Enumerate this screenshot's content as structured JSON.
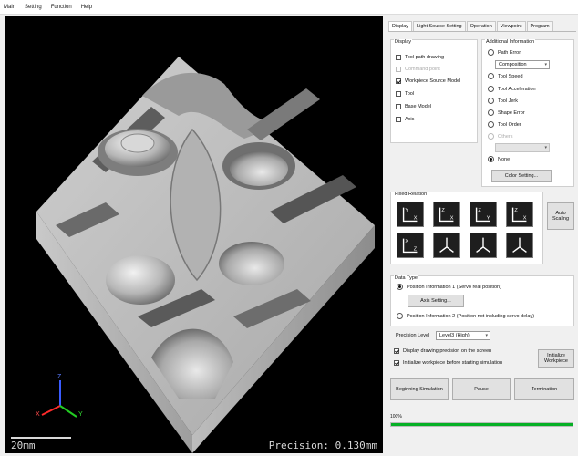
{
  "menu": [
    "Main",
    "Setting",
    "Function",
    "Help"
  ],
  "viewport": {
    "scale_label": "20mm",
    "precision_label": "Precision: 0.130mm",
    "axis_x": "X",
    "axis_y": "Y",
    "axis_z": "Z"
  },
  "tabs": [
    {
      "label": "Display",
      "active": true
    },
    {
      "label": "Light Source Setting",
      "active": false
    },
    {
      "label": "Operation",
      "active": false
    },
    {
      "label": "Viewpoint",
      "active": false
    },
    {
      "label": "Program",
      "active": false
    }
  ],
  "display_group": {
    "title": "Display",
    "items": [
      {
        "label": "Tool path drawing",
        "checked": false,
        "disabled": false
      },
      {
        "label": "Command point",
        "checked": false,
        "disabled": true
      },
      {
        "label": "Workpiece Source Model",
        "checked": true,
        "disabled": false
      },
      {
        "label": "Tool",
        "checked": false,
        "disabled": false
      },
      {
        "label": "Base Model",
        "checked": false,
        "disabled": false
      },
      {
        "label": "Axis",
        "checked": false,
        "disabled": false
      }
    ]
  },
  "additional_group": {
    "title": "Additional Information",
    "options": [
      {
        "label": "Path Error",
        "checked": false,
        "disabled": false
      },
      {
        "label": "Tool Speed",
        "checked": false,
        "disabled": false
      },
      {
        "label": "Tool Acceleration",
        "checked": false,
        "disabled": false
      },
      {
        "label": "Tool Jerk",
        "checked": false,
        "disabled": false
      },
      {
        "label": "Shape Error",
        "checked": false,
        "disabled": false
      },
      {
        "label": "Tool Order",
        "checked": false,
        "disabled": false
      },
      {
        "label": "Others",
        "checked": false,
        "disabled": true
      },
      {
        "label": "None",
        "checked": true,
        "disabled": false
      }
    ],
    "path_error_select": "Composition",
    "others_select": "",
    "color_setting_label": "Color Setting..."
  },
  "fixed_relation": {
    "title": "Fixed Relation",
    "buttons": [
      {
        "name": "view-yx",
        "a": "Y",
        "b": "X"
      },
      {
        "name": "view-xy",
        "a": "X",
        "b": "Y"
      },
      {
        "name": "view-zy",
        "a": "Z",
        "b": "Y"
      },
      {
        "name": "view-zx",
        "a": "Z",
        "b": "X"
      },
      {
        "name": "view-xz",
        "a": "X",
        "b": "Z"
      },
      {
        "name": "view-iso1",
        "a": "Z",
        "b": "X"
      },
      {
        "name": "view-iso2",
        "a": "Z",
        "b": "Y"
      },
      {
        "name": "view-iso3",
        "a": "Z",
        "b": "X"
      }
    ],
    "auto_scaling_label": "Auto Scaling"
  },
  "data_type": {
    "title": "Data Type",
    "option1": "Position Information 1 (Servo real position)",
    "option1_checked": true,
    "axis_setting_label": "Axis Setting...",
    "option2": "Position Information 2 (Position not including servo delay)",
    "option2_checked": false
  },
  "precision": {
    "label": "Precision Level",
    "value": "Level3 (High)"
  },
  "options": [
    {
      "label": "Display drawing precision on the screen",
      "checked": true
    },
    {
      "label": "Initialize workpiece before starting simulation",
      "checked": true
    }
  ],
  "initialize_label": "Initialize Workpiece",
  "controls": {
    "begin_label": "Beginning Simulation",
    "pause_label": "Pause",
    "terminate_label": "Termination"
  },
  "progress": {
    "label": "100%",
    "value": 100
  },
  "colors": {
    "progress": "#06b025",
    "viewport_bg": "#000000"
  }
}
